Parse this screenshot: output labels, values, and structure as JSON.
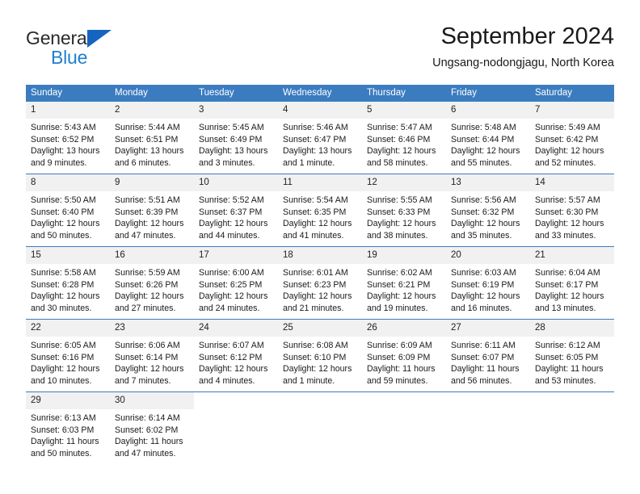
{
  "logo": {
    "primary": "General",
    "secondary": "Blue",
    "triangle_color": "#1565c0",
    "secondary_color": "#1f7fd0"
  },
  "header": {
    "title": "September 2024",
    "subtitle": "Ungsang-nodongjagu, North Korea"
  },
  "theme": {
    "header_bg": "#3b7cc0",
    "header_text": "#ffffff",
    "daynum_bg": "#f1f1f1",
    "row_border": "#3b7cc0"
  },
  "weekday_headers": [
    "Sunday",
    "Monday",
    "Tuesday",
    "Wednesday",
    "Thursday",
    "Friday",
    "Saturday"
  ],
  "weeks": [
    [
      {
        "day": "1",
        "sunrise": "Sunrise: 5:43 AM",
        "sunset": "Sunset: 6:52 PM",
        "daylight1": "Daylight: 13 hours",
        "daylight2": "and 9 minutes."
      },
      {
        "day": "2",
        "sunrise": "Sunrise: 5:44 AM",
        "sunset": "Sunset: 6:51 PM",
        "daylight1": "Daylight: 13 hours",
        "daylight2": "and 6 minutes."
      },
      {
        "day": "3",
        "sunrise": "Sunrise: 5:45 AM",
        "sunset": "Sunset: 6:49 PM",
        "daylight1": "Daylight: 13 hours",
        "daylight2": "and 3 minutes."
      },
      {
        "day": "4",
        "sunrise": "Sunrise: 5:46 AM",
        "sunset": "Sunset: 6:47 PM",
        "daylight1": "Daylight: 13 hours",
        "daylight2": "and 1 minute."
      },
      {
        "day": "5",
        "sunrise": "Sunrise: 5:47 AM",
        "sunset": "Sunset: 6:46 PM",
        "daylight1": "Daylight: 12 hours",
        "daylight2": "and 58 minutes."
      },
      {
        "day": "6",
        "sunrise": "Sunrise: 5:48 AM",
        "sunset": "Sunset: 6:44 PM",
        "daylight1": "Daylight: 12 hours",
        "daylight2": "and 55 minutes."
      },
      {
        "day": "7",
        "sunrise": "Sunrise: 5:49 AM",
        "sunset": "Sunset: 6:42 PM",
        "daylight1": "Daylight: 12 hours",
        "daylight2": "and 52 minutes."
      }
    ],
    [
      {
        "day": "8",
        "sunrise": "Sunrise: 5:50 AM",
        "sunset": "Sunset: 6:40 PM",
        "daylight1": "Daylight: 12 hours",
        "daylight2": "and 50 minutes."
      },
      {
        "day": "9",
        "sunrise": "Sunrise: 5:51 AM",
        "sunset": "Sunset: 6:39 PM",
        "daylight1": "Daylight: 12 hours",
        "daylight2": "and 47 minutes."
      },
      {
        "day": "10",
        "sunrise": "Sunrise: 5:52 AM",
        "sunset": "Sunset: 6:37 PM",
        "daylight1": "Daylight: 12 hours",
        "daylight2": "and 44 minutes."
      },
      {
        "day": "11",
        "sunrise": "Sunrise: 5:54 AM",
        "sunset": "Sunset: 6:35 PM",
        "daylight1": "Daylight: 12 hours",
        "daylight2": "and 41 minutes."
      },
      {
        "day": "12",
        "sunrise": "Sunrise: 5:55 AM",
        "sunset": "Sunset: 6:33 PM",
        "daylight1": "Daylight: 12 hours",
        "daylight2": "and 38 minutes."
      },
      {
        "day": "13",
        "sunrise": "Sunrise: 5:56 AM",
        "sunset": "Sunset: 6:32 PM",
        "daylight1": "Daylight: 12 hours",
        "daylight2": "and 35 minutes."
      },
      {
        "day": "14",
        "sunrise": "Sunrise: 5:57 AM",
        "sunset": "Sunset: 6:30 PM",
        "daylight1": "Daylight: 12 hours",
        "daylight2": "and 33 minutes."
      }
    ],
    [
      {
        "day": "15",
        "sunrise": "Sunrise: 5:58 AM",
        "sunset": "Sunset: 6:28 PM",
        "daylight1": "Daylight: 12 hours",
        "daylight2": "and 30 minutes."
      },
      {
        "day": "16",
        "sunrise": "Sunrise: 5:59 AM",
        "sunset": "Sunset: 6:26 PM",
        "daylight1": "Daylight: 12 hours",
        "daylight2": "and 27 minutes."
      },
      {
        "day": "17",
        "sunrise": "Sunrise: 6:00 AM",
        "sunset": "Sunset: 6:25 PM",
        "daylight1": "Daylight: 12 hours",
        "daylight2": "and 24 minutes."
      },
      {
        "day": "18",
        "sunrise": "Sunrise: 6:01 AM",
        "sunset": "Sunset: 6:23 PM",
        "daylight1": "Daylight: 12 hours",
        "daylight2": "and 21 minutes."
      },
      {
        "day": "19",
        "sunrise": "Sunrise: 6:02 AM",
        "sunset": "Sunset: 6:21 PM",
        "daylight1": "Daylight: 12 hours",
        "daylight2": "and 19 minutes."
      },
      {
        "day": "20",
        "sunrise": "Sunrise: 6:03 AM",
        "sunset": "Sunset: 6:19 PM",
        "daylight1": "Daylight: 12 hours",
        "daylight2": "and 16 minutes."
      },
      {
        "day": "21",
        "sunrise": "Sunrise: 6:04 AM",
        "sunset": "Sunset: 6:17 PM",
        "daylight1": "Daylight: 12 hours",
        "daylight2": "and 13 minutes."
      }
    ],
    [
      {
        "day": "22",
        "sunrise": "Sunrise: 6:05 AM",
        "sunset": "Sunset: 6:16 PM",
        "daylight1": "Daylight: 12 hours",
        "daylight2": "and 10 minutes."
      },
      {
        "day": "23",
        "sunrise": "Sunrise: 6:06 AM",
        "sunset": "Sunset: 6:14 PM",
        "daylight1": "Daylight: 12 hours",
        "daylight2": "and 7 minutes."
      },
      {
        "day": "24",
        "sunrise": "Sunrise: 6:07 AM",
        "sunset": "Sunset: 6:12 PM",
        "daylight1": "Daylight: 12 hours",
        "daylight2": "and 4 minutes."
      },
      {
        "day": "25",
        "sunrise": "Sunrise: 6:08 AM",
        "sunset": "Sunset: 6:10 PM",
        "daylight1": "Daylight: 12 hours",
        "daylight2": "and 1 minute."
      },
      {
        "day": "26",
        "sunrise": "Sunrise: 6:09 AM",
        "sunset": "Sunset: 6:09 PM",
        "daylight1": "Daylight: 11 hours",
        "daylight2": "and 59 minutes."
      },
      {
        "day": "27",
        "sunrise": "Sunrise: 6:11 AM",
        "sunset": "Sunset: 6:07 PM",
        "daylight1": "Daylight: 11 hours",
        "daylight2": "and 56 minutes."
      },
      {
        "day": "28",
        "sunrise": "Sunrise: 6:12 AM",
        "sunset": "Sunset: 6:05 PM",
        "daylight1": "Daylight: 11 hours",
        "daylight2": "and 53 minutes."
      }
    ],
    [
      {
        "day": "29",
        "sunrise": "Sunrise: 6:13 AM",
        "sunset": "Sunset: 6:03 PM",
        "daylight1": "Daylight: 11 hours",
        "daylight2": "and 50 minutes."
      },
      {
        "day": "30",
        "sunrise": "Sunrise: 6:14 AM",
        "sunset": "Sunset: 6:02 PM",
        "daylight1": "Daylight: 11 hours",
        "daylight2": "and 47 minutes."
      },
      {
        "day": "",
        "sunrise": "",
        "sunset": "",
        "daylight1": "",
        "daylight2": ""
      },
      {
        "day": "",
        "sunrise": "",
        "sunset": "",
        "daylight1": "",
        "daylight2": ""
      },
      {
        "day": "",
        "sunrise": "",
        "sunset": "",
        "daylight1": "",
        "daylight2": ""
      },
      {
        "day": "",
        "sunrise": "",
        "sunset": "",
        "daylight1": "",
        "daylight2": ""
      },
      {
        "day": "",
        "sunrise": "",
        "sunset": "",
        "daylight1": "",
        "daylight2": ""
      }
    ]
  ]
}
